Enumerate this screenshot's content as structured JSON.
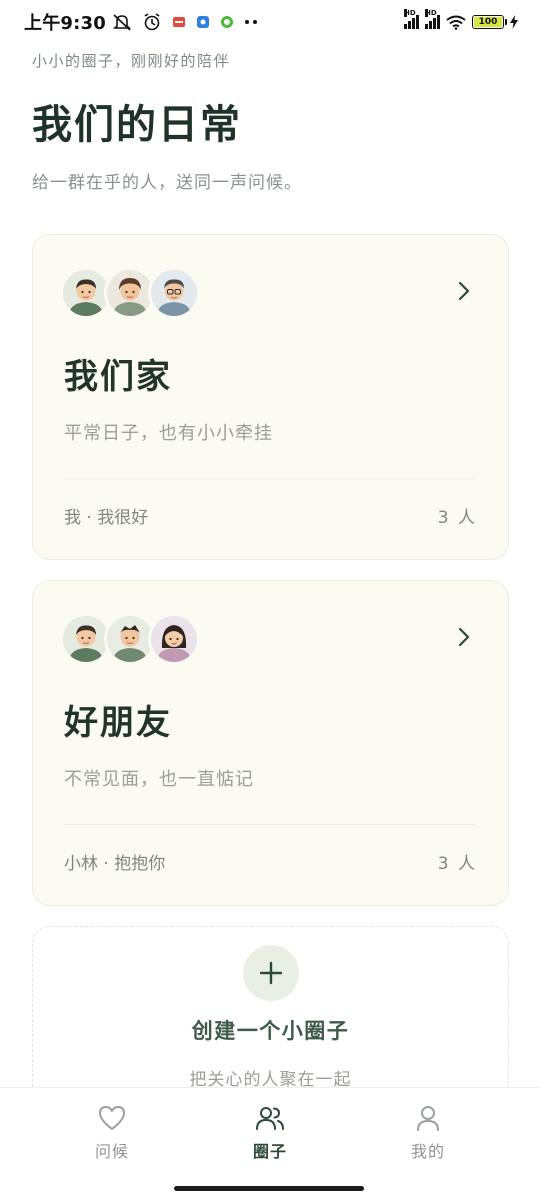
{
  "status_bar": {
    "time": "上午9:30",
    "network_labels": [
      "HD",
      "HD"
    ],
    "battery": "100"
  },
  "header": {
    "eyebrow": "小小的圈子，刚刚好的陪伴",
    "title": "我们的日常",
    "subtitle": "给一群在乎的人，送同一声问候。"
  },
  "circles": [
    {
      "name": "我们家",
      "description": "平常日子，也有小小牵挂",
      "status": "我 · 我很好",
      "count": "3 人"
    },
    {
      "name": "好朋友",
      "description": "不常见面，也一直惦记",
      "status": "小林 · 抱抱你",
      "count": "3 人"
    }
  ],
  "create": {
    "title": "创建一个小圈子",
    "description": "把关心的人聚在一起"
  },
  "nav": {
    "items": [
      {
        "label": "问候",
        "icon": "heart-icon",
        "active": false
      },
      {
        "label": "圈子",
        "icon": "group-icon",
        "active": true
      },
      {
        "label": "我的",
        "icon": "person-icon",
        "active": false
      }
    ]
  },
  "colors": {
    "accent": "#2d4a38",
    "card_bg": "#fbfbf3",
    "muted_text": "#9a9f98"
  }
}
